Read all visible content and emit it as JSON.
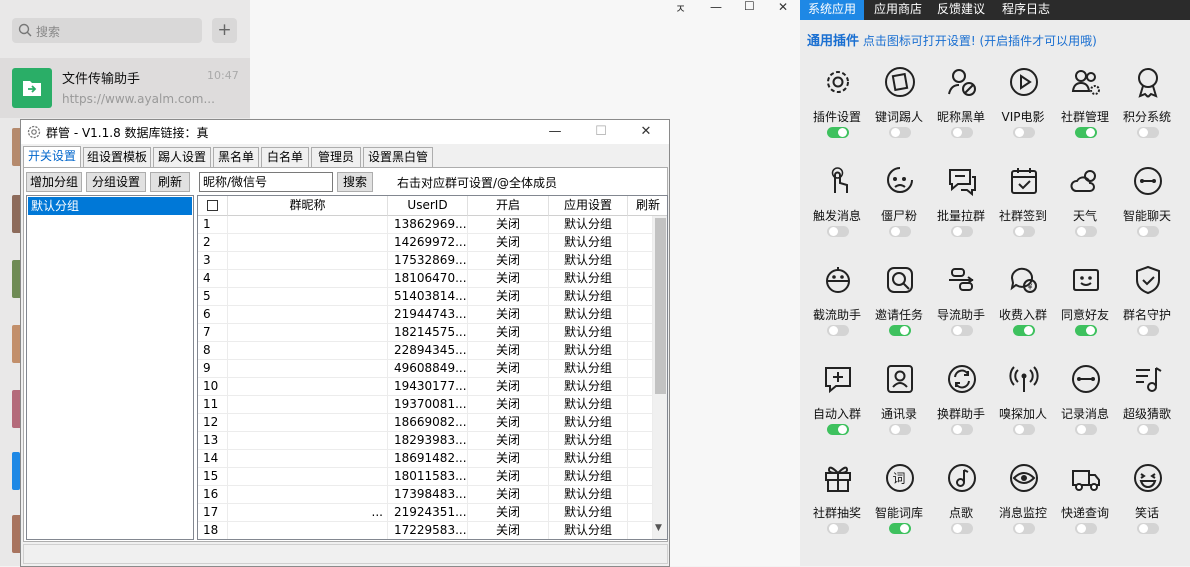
{
  "wechat": {
    "search_placeholder": "搜索",
    "plus_label": "+",
    "chat_item": {
      "name": "文件传输助手",
      "time": "10:47",
      "preview": "https://www.ayalm.com..."
    },
    "window_controls": {
      "pin": "ㅈ",
      "min": "—",
      "max": "☐",
      "close": "✕"
    }
  },
  "qun_window": {
    "title": "群管 - V1.1.8  数据库链接：真",
    "title_controls": {
      "min": "—",
      "max": "☐",
      "close": "✕"
    },
    "tabs": [
      {
        "label": "开关设置",
        "active": true
      },
      {
        "label": "组设置模板"
      },
      {
        "label": "踢人设置"
      },
      {
        "label": "黑名单"
      },
      {
        "label": "白名单"
      },
      {
        "label": "管理员"
      },
      {
        "label": "设置黑白管"
      }
    ],
    "toolbar": {
      "add_group": "增加分组",
      "group_settings": "分组设置",
      "refresh": "刷新",
      "search_value": "昵称/微信号",
      "search": "搜索",
      "hint": "右击对应群可设置/@全体成员"
    },
    "group_list": [
      "默认分组"
    ],
    "grid": {
      "headers": [
        "群昵称",
        "UserID",
        "开启",
        "应用设置",
        "刷新"
      ],
      "rows": [
        {
          "idx": "1",
          "nick": "",
          "uid": "13862969...",
          "open": "关闭",
          "app": "默认分组"
        },
        {
          "idx": "2",
          "nick": "",
          "uid": "14269972...",
          "open": "关闭",
          "app": "默认分组"
        },
        {
          "idx": "3",
          "nick": "",
          "uid": "17532869...",
          "open": "关闭",
          "app": "默认分组"
        },
        {
          "idx": "4",
          "nick": "",
          "uid": "18106470...",
          "open": "关闭",
          "app": "默认分组"
        },
        {
          "idx": "5",
          "nick": "",
          "uid": "51403814...",
          "open": "关闭",
          "app": "默认分组"
        },
        {
          "idx": "6",
          "nick": "",
          "uid": "21944743...",
          "open": "关闭",
          "app": "默认分组"
        },
        {
          "idx": "7",
          "nick": "",
          "uid": "18214575...",
          "open": "关闭",
          "app": "默认分组"
        },
        {
          "idx": "8",
          "nick": "",
          "uid": "22894345...",
          "open": "关闭",
          "app": "默认分组"
        },
        {
          "idx": "9",
          "nick": "",
          "uid": "49608849...",
          "open": "关闭",
          "app": "默认分组"
        },
        {
          "idx": "10",
          "nick": "",
          "uid": "19430177...",
          "open": "关闭",
          "app": "默认分组"
        },
        {
          "idx": "11",
          "nick": "",
          "uid": "19370081...",
          "open": "关闭",
          "app": "默认分组"
        },
        {
          "idx": "12",
          "nick": "",
          "uid": "18669082...",
          "open": "关闭",
          "app": "默认分组"
        },
        {
          "idx": "13",
          "nick": "",
          "uid": "18293983...",
          "open": "关闭",
          "app": "默认分组"
        },
        {
          "idx": "14",
          "nick": "",
          "uid": "18691482...",
          "open": "关闭",
          "app": "默认分组"
        },
        {
          "idx": "15",
          "nick": "",
          "uid": "18011583...",
          "open": "关闭",
          "app": "默认分组"
        },
        {
          "idx": "16",
          "nick": "",
          "uid": "17398483...",
          "open": "关闭",
          "app": "默认分组"
        },
        {
          "idx": "17",
          "nick": "...",
          "uid": "21924351...",
          "open": "关闭",
          "app": "默认分组"
        },
        {
          "idx": "18",
          "nick": "",
          "uid": "17229583...",
          "open": "关闭",
          "app": "默认分组"
        }
      ]
    }
  },
  "plugin_panel": {
    "tabs": [
      {
        "label": "系统应用",
        "active": true
      },
      {
        "label": "应用商店"
      },
      {
        "label": "反馈建议"
      },
      {
        "label": "程序日志"
      }
    ],
    "header_bold": "通用插件",
    "header_hint": "点击图标可打开设置!",
    "header_note": "(开启插件才可以用哦)",
    "plugins": [
      {
        "label": "插件设置",
        "icon": "gear-icon",
        "on": true
      },
      {
        "label": "键词踢人",
        "icon": "note-icon",
        "on": false
      },
      {
        "label": "昵称黑单",
        "icon": "user-ban-icon",
        "on": false
      },
      {
        "label": "VIP电影",
        "icon": "play-icon",
        "on": false
      },
      {
        "label": "社群管理",
        "icon": "group-settings-icon",
        "on": true
      },
      {
        "label": "积分系统",
        "icon": "medal-icon",
        "on": false
      },
      {
        "label": "触发消息",
        "icon": "touch-icon",
        "on": false
      },
      {
        "label": "僵尸粉",
        "icon": "zombie-icon",
        "on": false
      },
      {
        "label": "批量拉群",
        "icon": "chat-bubbles-icon",
        "on": false
      },
      {
        "label": "社群签到",
        "icon": "calendar-check-icon",
        "on": false
      },
      {
        "label": "天气",
        "icon": "weather-icon",
        "on": false
      },
      {
        "label": "智能聊天",
        "icon": "dots-circle-icon",
        "on": false
      },
      {
        "label": "截流助手",
        "icon": "robot-icon",
        "on": false
      },
      {
        "label": "邀请任务",
        "icon": "magnifier-icon",
        "on": true
      },
      {
        "label": "导流助手",
        "icon": "flow-icon",
        "on": false
      },
      {
        "label": "收费入群",
        "icon": "paid-chat-icon",
        "on": true
      },
      {
        "label": "同意好友",
        "icon": "smile-face-icon",
        "on": true
      },
      {
        "label": "群名守护",
        "icon": "shield-icon",
        "on": false
      },
      {
        "label": "自动入群",
        "icon": "chat-add-icon",
        "on": true
      },
      {
        "label": "通讯录",
        "icon": "contacts-icon",
        "on": false
      },
      {
        "label": "换群助手",
        "icon": "swap-icon",
        "on": false
      },
      {
        "label": "嗅探加人",
        "icon": "antenna-icon",
        "on": false
      },
      {
        "label": "记录消息",
        "icon": "record-icon",
        "on": false
      },
      {
        "label": "超级猜歌",
        "icon": "music-list-icon",
        "on": false
      },
      {
        "label": "社群抽奖",
        "icon": "gift-icon",
        "on": false
      },
      {
        "label": "智能词库",
        "icon": "word-icon",
        "on": true
      },
      {
        "label": "点歌",
        "icon": "music-note-icon",
        "on": false
      },
      {
        "label": "消息监控",
        "icon": "eye-icon",
        "on": false
      },
      {
        "label": "快递查询",
        "icon": "truck-icon",
        "on": false
      },
      {
        "label": "笑话",
        "icon": "laugh-icon",
        "on": false
      }
    ]
  }
}
